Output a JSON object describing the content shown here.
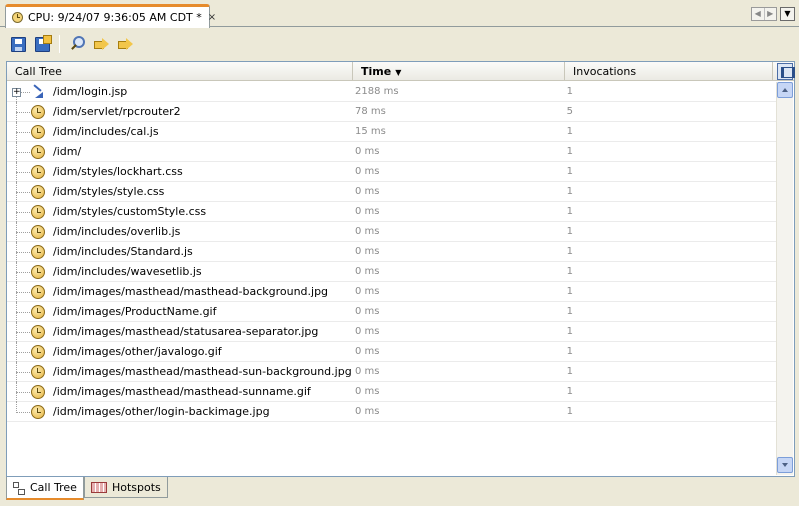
{
  "window": {
    "tab_title": "CPU: 9/24/07 9:36:05 AM CDT *",
    "tab_close_glyph": "×"
  },
  "tab_nav": {
    "prev_glyph": "◀",
    "next_glyph": "▶",
    "menu_glyph": "▼"
  },
  "toolbar": {
    "icons": [
      "save-icon",
      "save-as-icon",
      "find-icon",
      "find-previous-icon",
      "find-next-icon"
    ]
  },
  "table": {
    "columns": [
      "Call Tree",
      "Time",
      "Invocations"
    ],
    "sort_column": "Time",
    "sort_glyph": "▼",
    "rows": [
      {
        "name": "/idm/login.jsp",
        "time": "2188 ms",
        "invocations": "1",
        "icon": "method-icon",
        "expandable": true
      },
      {
        "name": "/idm/servlet/rpcrouter2",
        "time": "78 ms",
        "invocations": "5",
        "icon": "clock-icon"
      },
      {
        "name": "/idm/includes/cal.js",
        "time": "15 ms",
        "invocations": "1",
        "icon": "clock-icon"
      },
      {
        "name": "/idm/",
        "time": "0 ms",
        "invocations": "1",
        "icon": "clock-icon"
      },
      {
        "name": "/idm/styles/lockhart.css",
        "time": "0 ms",
        "invocations": "1",
        "icon": "clock-icon"
      },
      {
        "name": "/idm/styles/style.css",
        "time": "0 ms",
        "invocations": "1",
        "icon": "clock-icon"
      },
      {
        "name": "/idm/styles/customStyle.css",
        "time": "0 ms",
        "invocations": "1",
        "icon": "clock-icon"
      },
      {
        "name": "/idm/includes/overlib.js",
        "time": "0 ms",
        "invocations": "1",
        "icon": "clock-icon"
      },
      {
        "name": "/idm/includes/Standard.js",
        "time": "0 ms",
        "invocations": "1",
        "icon": "clock-icon"
      },
      {
        "name": "/idm/includes/wavesetlib.js",
        "time": "0 ms",
        "invocations": "1",
        "icon": "clock-icon"
      },
      {
        "name": "/idm/images/masthead/masthead-background.jpg",
        "time": "0 ms",
        "invocations": "1",
        "icon": "clock-icon"
      },
      {
        "name": "/idm/images/ProductName.gif",
        "time": "0 ms",
        "invocations": "1",
        "icon": "clock-icon"
      },
      {
        "name": "/idm/images/masthead/statusarea-separator.jpg",
        "time": "0 ms",
        "invocations": "1",
        "icon": "clock-icon"
      },
      {
        "name": "/idm/images/other/javalogo.gif",
        "time": "0 ms",
        "invocations": "1",
        "icon": "clock-icon"
      },
      {
        "name": "/idm/images/masthead/masthead-sun-background.jpg",
        "time": "0 ms",
        "invocations": "1",
        "icon": "clock-icon"
      },
      {
        "name": "/idm/images/masthead/masthead-sunname.gif",
        "time": "0 ms",
        "invocations": "1",
        "icon": "clock-icon"
      },
      {
        "name": "/idm/images/other/login-backimage.jpg",
        "time": "0 ms",
        "invocations": "1",
        "icon": "clock-icon"
      }
    ]
  },
  "bottom_tabs": [
    {
      "label": "Call Tree",
      "active": true
    },
    {
      "label": "Hotspots",
      "active": false
    }
  ],
  "colors": {
    "active_tab_accent": "#E68B2C",
    "panel_border": "#7F9DB9",
    "muted_value_text": "#8C8C8C"
  }
}
